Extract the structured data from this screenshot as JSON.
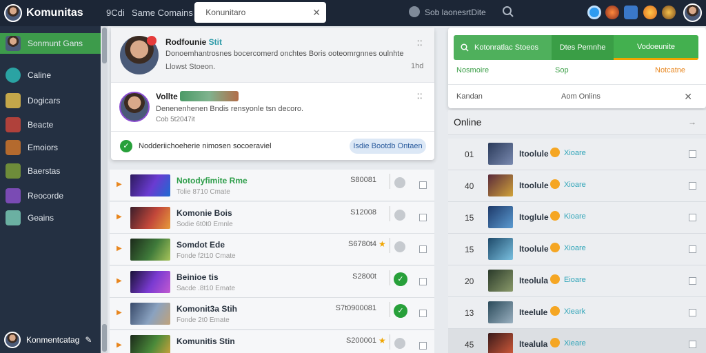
{
  "topbar": {
    "brand": "Komunitas",
    "tab1": "9Cdi",
    "tab2": "Same Comains",
    "search_value": "Konunitaro",
    "gear_label": "Sob laonesrtDite"
  },
  "sidebar": {
    "items": [
      {
        "label": "Sonmunt Gans",
        "icon": "users-icon",
        "color": "#3d9b4b"
      },
      {
        "label": "Caline",
        "icon": "online-icon",
        "color": "#2aa3a3"
      },
      {
        "label": "Dogicars",
        "icon": "game-icon",
        "color": "#c4a74a"
      },
      {
        "label": "Beacte",
        "icon": "game-icon",
        "color": "#b0413b"
      },
      {
        "label": "Emoiors",
        "icon": "game-icon",
        "color": "#b46a2e"
      },
      {
        "label": "Baerstas",
        "icon": "game-icon",
        "color": "#6e8c3a"
      },
      {
        "label": "Reocorde",
        "icon": "game-icon",
        "color": "#7a4bb4"
      },
      {
        "label": "Geains",
        "icon": "game-icon",
        "color": "#6bb0a2"
      }
    ],
    "footer_label": "Konmentcatag"
  },
  "notifications": {
    "n1": {
      "title": "Rodfounie",
      "title_accent": "Stit",
      "text": "Donoemhantrosnes bocercomerd onchtes Boris ooteomrgnnes oulnhte",
      "text2": "Llowst Stoeon.",
      "time": "1hd"
    },
    "n2": {
      "title": "Vollte",
      "text": "Denenenhenen Bndis rensyonle tsn decoro.",
      "time": "Cob 5t2047it"
    },
    "n3": {
      "text": "Nodderiichoeherie nimosen socoeraviel",
      "button": "Isdie Bootdb Ontaen"
    }
  },
  "games": [
    {
      "title": "Notodyfimite Rme",
      "sub": "Tolie 8710 Cmate",
      "price": "S80081",
      "mark": "grey",
      "star": false,
      "title_green": true,
      "colors": [
        "#2d1a5e",
        "#6a3bd1",
        "#1e6bd1"
      ]
    },
    {
      "title": "Komonie Bois",
      "sub": "Sodie 6t0t0 Emnle",
      "price": "S12008",
      "mark": "grey",
      "star": false,
      "title_green": false,
      "colors": [
        "#3a1d2a",
        "#c2473a",
        "#e79b3a"
      ]
    },
    {
      "title": "Somdot Ede",
      "sub": "Fonde f2t10 Cmate",
      "price": "S6780t4",
      "mark": "grey",
      "star": true,
      "title_green": false,
      "colors": [
        "#1b2a1a",
        "#3f7a3a",
        "#a7c45a"
      ]
    },
    {
      "title": "Beinioe tis",
      "sub": "Sacde .8t10 Emate",
      "price": "S2800t",
      "mark": "green",
      "star": false,
      "title_green": false,
      "colors": [
        "#1a1238",
        "#7a3ad1",
        "#c25ad1"
      ]
    },
    {
      "title": "Komonit3a Stih",
      "sub": "Fonde 2t0 Emate",
      "price": "S7t0900081",
      "mark": "green",
      "star": false,
      "title_green": false,
      "colors": [
        "#384a6a",
        "#8aa2c0",
        "#c0a27a"
      ]
    },
    {
      "title": "Komunitis Stin",
      "sub": "",
      "price": "S200001",
      "mark": "grey",
      "star": true,
      "title_green": false,
      "colors": [
        "#1b2a1a",
        "#4a8a3a",
        "#d1a33a"
      ]
    }
  ],
  "right": {
    "tabs": [
      "Kotonratlac Stoeos",
      "Dtes Pemnhe",
      "Vodoeunite"
    ],
    "sub_labels": [
      "Nosmoire",
      "Sop",
      "Notcatne"
    ],
    "sub_colors": [
      "#3a9e46",
      "#3a9e46",
      "#e8861e"
    ],
    "online_row_left": "Kandan",
    "online_row_mid": "Aom Onlins"
  },
  "online": {
    "title": "Online",
    "players": [
      {
        "num": "01",
        "name": "Itoolule",
        "status": "Xioare",
        "colors": [
          "#2a3a5a",
          "#7a8ab0"
        ]
      },
      {
        "num": "40",
        "name": "Itoolule",
        "status": "Xioare",
        "colors": [
          "#5a2a3a",
          "#d1a33a"
        ]
      },
      {
        "num": "15",
        "name": "Itoglule",
        "status": "Kioare",
        "colors": [
          "#1e3a6a",
          "#5a9ad1"
        ]
      },
      {
        "num": "15",
        "name": "Itoolule",
        "status": "Xioare",
        "colors": [
          "#1e4a6a",
          "#7ac0e0"
        ]
      },
      {
        "num": "20",
        "name": "Iteolula",
        "status": "Eioare",
        "colors": [
          "#2a3a2a",
          "#8a9a6a"
        ]
      },
      {
        "num": "13",
        "name": "Iteelule",
        "status": "Xieark",
        "colors": [
          "#2a4a5a",
          "#9ab0c0"
        ]
      },
      {
        "num": "45",
        "name": "Itealula",
        "status": "Xieare",
        "colors": [
          "#3a1a1a",
          "#d15a3a"
        ]
      }
    ]
  }
}
